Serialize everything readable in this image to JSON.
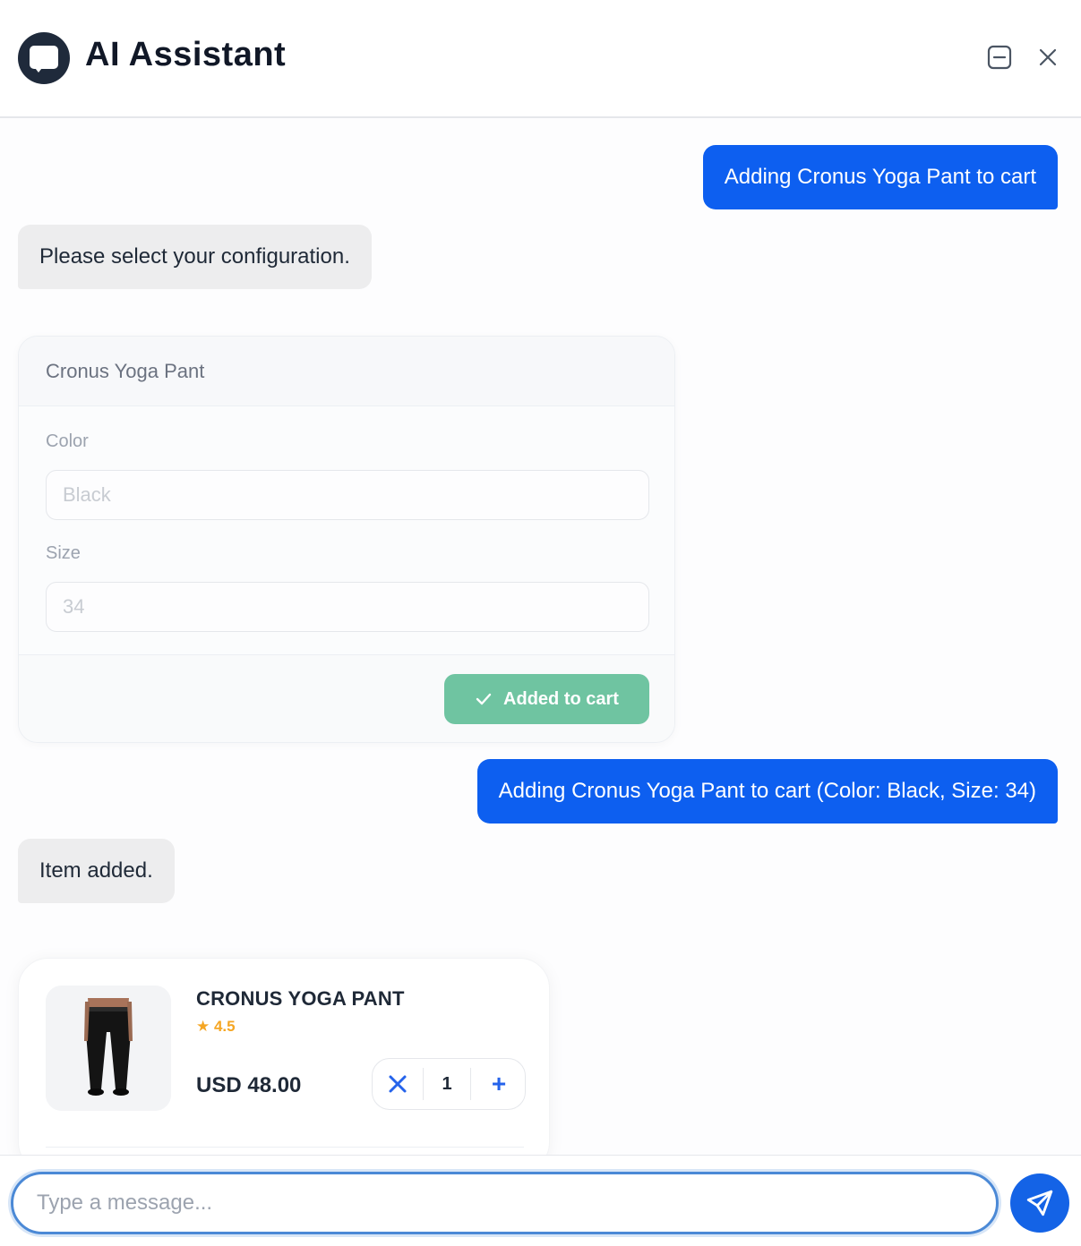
{
  "header": {
    "title": "AI Assistant",
    "icons": {
      "logo": "chat-bubble-icon",
      "minimize": "minimize-icon",
      "close": "close-icon"
    }
  },
  "messages": [
    {
      "role": "user",
      "text": "Adding Cronus Yoga Pant to cart"
    },
    {
      "role": "assistant",
      "text": "Please select your configuration."
    },
    {
      "role": "user",
      "text": "Adding Cronus Yoga Pant to cart (Color: Black, Size: 34)"
    },
    {
      "role": "assistant",
      "text": "Item added."
    }
  ],
  "config_card": {
    "title": "Cronus Yoga Pant",
    "color_label": "Color",
    "color_value": "Black",
    "size_label": "Size",
    "size_value": "34",
    "button_label": "Added to cart",
    "button_icon": "check-icon"
  },
  "product_card": {
    "name": "CRONUS YOGA PANT",
    "rating": "★ 4.5",
    "price": "USD 48.00",
    "quantity": "1",
    "image": "yoga-pant-product-image",
    "remove_icon": "remove-x-icon",
    "add_icon": "plus-icon",
    "add_label": "+"
  },
  "composer": {
    "placeholder": "Type a message...",
    "send_icon": "send-icon"
  },
  "colors": {
    "user_bubble": "#0d5ff0",
    "bot_bubble": "#ededee",
    "success": "#6fc4a1",
    "rating": "#f5a623",
    "accent": "#1463e6"
  }
}
